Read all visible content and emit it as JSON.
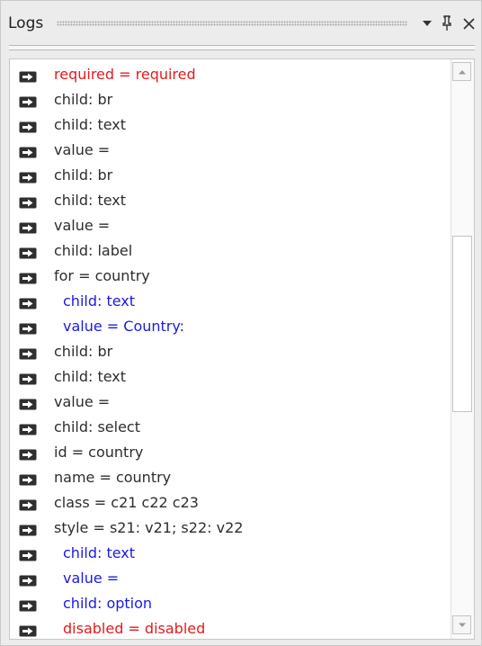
{
  "panel": {
    "title": "Logs"
  },
  "icons": {
    "dropdown": "chevron-down-icon",
    "pin": "pin-icon",
    "close": "close-icon",
    "entry": "arrow-icon",
    "scroll_up": "scroll-up-icon",
    "scroll_down": "scroll-down-icon"
  },
  "colors": {
    "default_text": "#2d2d2d",
    "blue_text": "#1a1ae6",
    "red_text": "#e31b1b"
  },
  "log": {
    "entries": [
      {
        "text": "required = required",
        "color": "red",
        "indent": 0
      },
      {
        "text": "child: br",
        "color": "default",
        "indent": 0
      },
      {
        "text": "child: text",
        "color": "default",
        "indent": 0
      },
      {
        "text": "value =",
        "color": "default",
        "indent": 0
      },
      {
        "text": "child: br",
        "color": "default",
        "indent": 0
      },
      {
        "text": "child: text",
        "color": "default",
        "indent": 0
      },
      {
        "text": "value =",
        "color": "default",
        "indent": 0
      },
      {
        "text": "child: label",
        "color": "default",
        "indent": 0
      },
      {
        "text": "for = country",
        "color": "default",
        "indent": 0
      },
      {
        "text": "child: text",
        "color": "blue",
        "indent": 1
      },
      {
        "text": "value = Country:",
        "color": "blue",
        "indent": 1
      },
      {
        "text": "child: br",
        "color": "default",
        "indent": 0
      },
      {
        "text": "child: text",
        "color": "default",
        "indent": 0
      },
      {
        "text": "value =",
        "color": "default",
        "indent": 0
      },
      {
        "text": "child: select",
        "color": "default",
        "indent": 0
      },
      {
        "text": "id = country",
        "color": "default",
        "indent": 0
      },
      {
        "text": "name = country",
        "color": "default",
        "indent": 0
      },
      {
        "text": "class = c21 c22 c23",
        "color": "default",
        "indent": 0
      },
      {
        "text": "style = s21: v21; s22: v22",
        "color": "default",
        "indent": 0
      },
      {
        "text": "child: text",
        "color": "blue",
        "indent": 1
      },
      {
        "text": "value =",
        "color": "blue",
        "indent": 1
      },
      {
        "text": "child: option",
        "color": "blue",
        "indent": 1
      },
      {
        "text": "disabled = disabled",
        "color": "red",
        "indent": 1
      }
    ]
  }
}
